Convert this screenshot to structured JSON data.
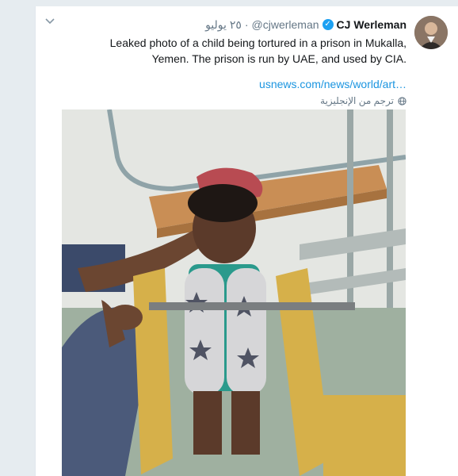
{
  "tweet": {
    "display_name": "CJ Werleman",
    "handle": "@cjwerleman",
    "separator": "·",
    "date": "٢٥ يوليو",
    "text": "Leaked photo of a child being tortured in a prison in Mukalla, Yemen. The prison is run by UAE, and used by CIA.",
    "link_text": "usnews.com/news/world/art…",
    "translate_label": "ترجم من الإنجليزية",
    "verified_mark": "✓",
    "caret_icon": "chevron-down-icon"
  },
  "colors": {
    "background": "#e6ecf0",
    "card": "#ffffff",
    "link": "#1b95e0",
    "verified": "#1da1f2",
    "secondary_text": "#657786"
  }
}
